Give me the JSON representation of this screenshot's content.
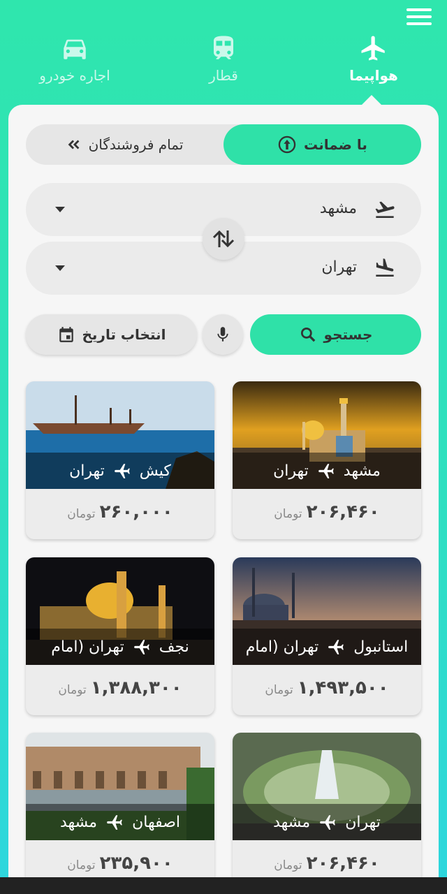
{
  "tabs": [
    {
      "label": "هواپیما",
      "icon": "airplane-icon",
      "active": true
    },
    {
      "label": "قطار",
      "icon": "train-icon",
      "active": false
    },
    {
      "label": "اجاره خودرو",
      "icon": "car-icon",
      "active": false
    }
  ],
  "segment": {
    "guarantee_label": "با ضمانت",
    "all_sellers_label": "تمام فروشندگان"
  },
  "origin": {
    "value": "مشهد"
  },
  "destination": {
    "value": "تهران"
  },
  "actions": {
    "search_label": "جستجو",
    "date_label": "انتخاب تاریخ"
  },
  "currency": "تومان",
  "cards": [
    {
      "from": "مشهد",
      "to": "تهران",
      "price": "۲۰۶,۴۶۰"
    },
    {
      "from": "کیش",
      "to": "تهران",
      "price": "۲۶۰,۰۰۰"
    },
    {
      "from": "استانبول",
      "to": "تهران (امام",
      "price": "۱,۴۹۳,۵۰۰"
    },
    {
      "from": "نجف",
      "to": "تهران (امام",
      "price": "۱,۳۸۸,۳۰۰"
    },
    {
      "from": "تهران",
      "to": "مشهد",
      "price": "۲۰۶,۴۶۰"
    },
    {
      "from": "اصفهان",
      "to": "مشهد",
      "price": "۲۳۵,۹۰۰"
    }
  ],
  "colors": {
    "accent": "#2fe1a8",
    "panel": "#f6f6f6"
  }
}
